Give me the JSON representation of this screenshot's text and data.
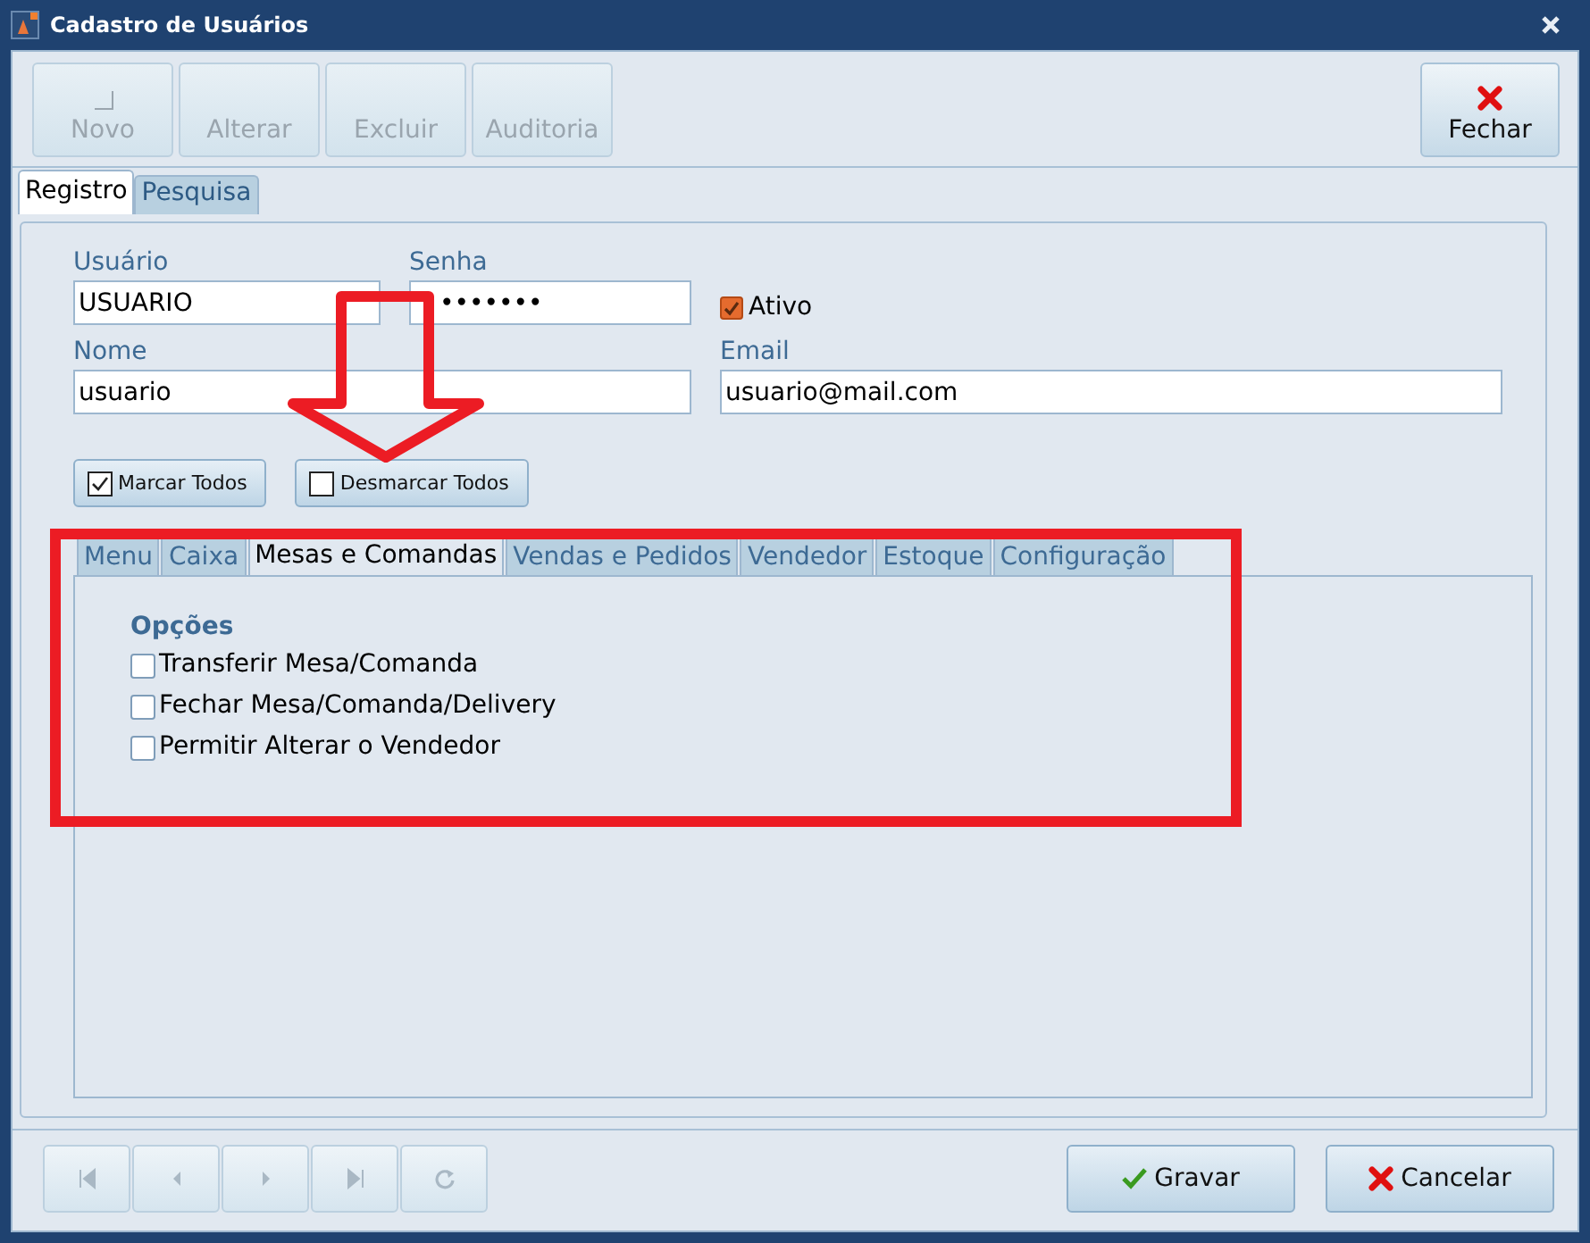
{
  "window": {
    "title": "Cadastro de Usuários"
  },
  "toolbar": [
    {
      "label": "Novo",
      "disabled": true,
      "kind": "new"
    },
    {
      "label": "Alterar",
      "disabled": true,
      "kind": "none"
    },
    {
      "label": "Excluir",
      "disabled": true,
      "kind": "none"
    },
    {
      "label": "Auditoria",
      "disabled": true,
      "kind": "none"
    },
    {
      "label": "Fechar",
      "disabled": false,
      "kind": "close"
    }
  ],
  "tabs": [
    {
      "label": "Registro",
      "selected": true
    },
    {
      "label": "Pesquisa",
      "selected": false
    }
  ],
  "form": {
    "usuario": {
      "label": "Usuário",
      "value": "USUARIO"
    },
    "senha": {
      "label": "Senha",
      "value": "•••••••"
    },
    "ativo": {
      "label": "Ativo",
      "checked": true
    },
    "nome": {
      "label": "Nome",
      "value": "usuario"
    },
    "email": {
      "label": "Email",
      "value": "usuario@mail.com"
    }
  },
  "bulk_buttons": [
    {
      "label": "Marcar Todos",
      "kind": "check"
    },
    {
      "label": "Desmarcar Todos",
      "kind": "uncheck"
    }
  ],
  "permission_tabs": [
    {
      "label": "Menu",
      "selected": false
    },
    {
      "label": "Caixa",
      "selected": false
    },
    {
      "label": "Mesas e Comandas",
      "selected": true
    },
    {
      "label": "Vendas e Pedidos",
      "selected": false
    },
    {
      "label": "Vendedor",
      "selected": false
    },
    {
      "label": "Estoque",
      "selected": false
    },
    {
      "label": "Configuração",
      "selected": false
    }
  ],
  "options": {
    "title": "Opções",
    "items": [
      {
        "label": "Transferir Mesa/Comanda",
        "checked": false
      },
      {
        "label": "Fechar Mesa/Comanda/Delivery",
        "checked": false
      },
      {
        "label": "Permitir Alterar o Vendedor",
        "checked": false
      }
    ]
  },
  "navigation": [
    {
      "kind": "first",
      "disabled": true
    },
    {
      "kind": "prev",
      "disabled": true
    },
    {
      "kind": "next",
      "disabled": true
    },
    {
      "kind": "last",
      "disabled": true
    },
    {
      "kind": "refresh",
      "disabled": true
    }
  ],
  "actions": [
    {
      "label": "Gravar",
      "kind": "save"
    },
    {
      "label": "Cancelar",
      "kind": "cancel"
    }
  ]
}
